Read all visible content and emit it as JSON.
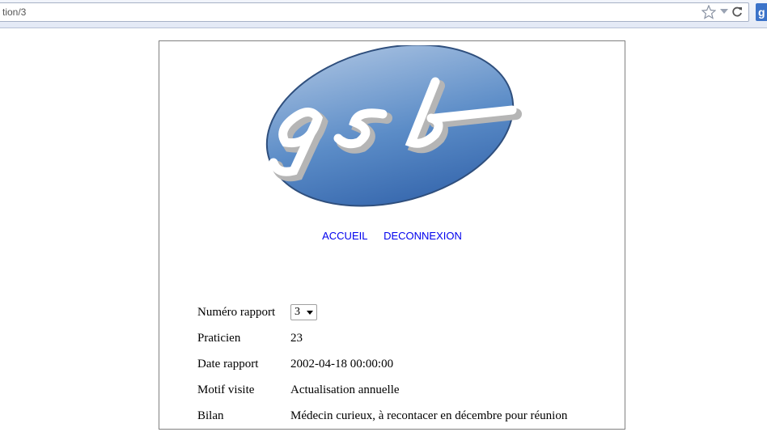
{
  "browser": {
    "url_visible": "tion/3"
  },
  "logo": {
    "icon": "gsb-logo"
  },
  "nav": {
    "items": [
      {
        "label": "ACCUEIL"
      },
      {
        "label": "DECONNEXION"
      }
    ]
  },
  "report": {
    "rows": [
      {
        "label": "Numéro rapport",
        "value": "3"
      },
      {
        "label": "Praticien",
        "value": "23"
      },
      {
        "label": "Date rapport",
        "value": "2002-04-18 00:00:00"
      },
      {
        "label": "Motif visite",
        "value": "Actualisation annuelle"
      },
      {
        "label": "Bilan",
        "value": "Médecin curieux, à recontacer en décembre pour réunion"
      }
    ]
  },
  "colors": {
    "link": "#0000ee",
    "logo_blue": "#5b8cc7"
  }
}
